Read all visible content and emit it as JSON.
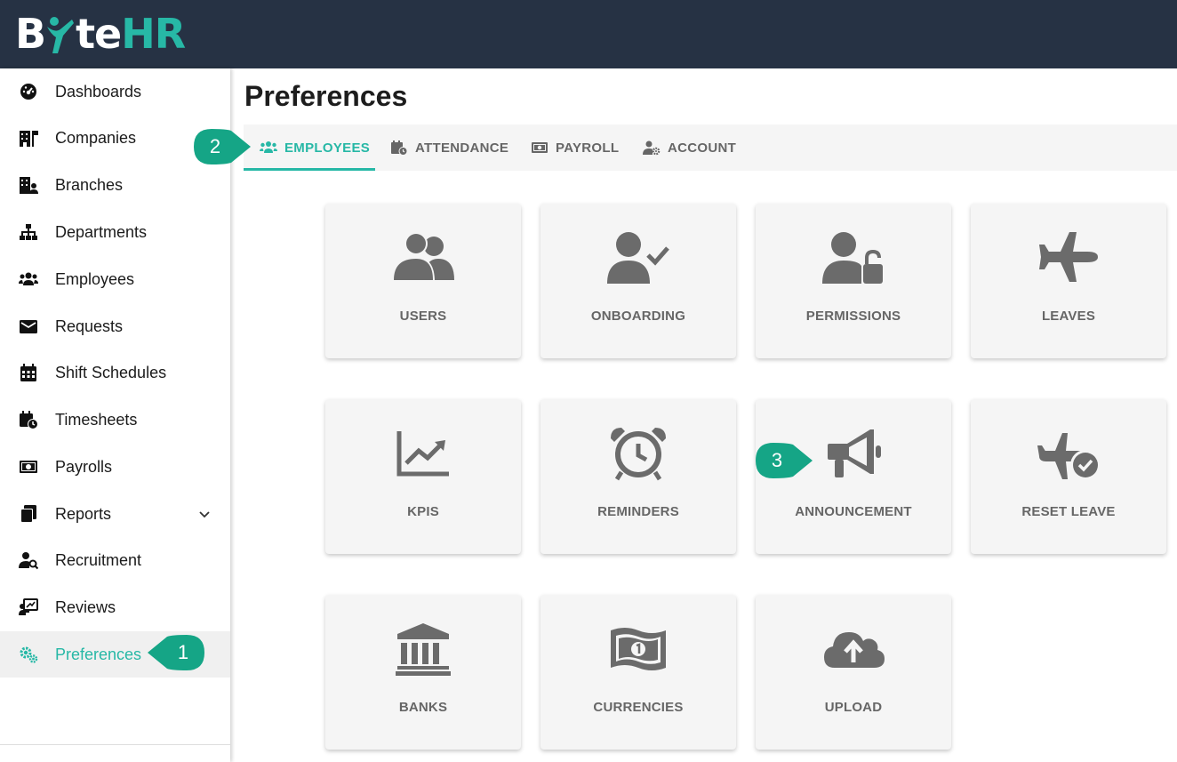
{
  "brand": {
    "logo_text": "ByteHR",
    "logo_part1": "B",
    "logo_part2": "te",
    "logo_part3": "HR",
    "accent": "#27b8a6",
    "header_bg": "#263244"
  },
  "sidebar": {
    "items": [
      {
        "label": "Dashboards",
        "icon": "dashboard-gauge-icon"
      },
      {
        "label": "Companies",
        "icon": "building-flag-icon"
      },
      {
        "label": "Branches",
        "icon": "building-user-icon"
      },
      {
        "label": "Departments",
        "icon": "org-chart-icon"
      },
      {
        "label": "Employees",
        "icon": "users-icon"
      },
      {
        "label": "Requests",
        "icon": "envelope-icon"
      },
      {
        "label": "Shift Schedules",
        "icon": "calendar-icon"
      },
      {
        "label": "Timesheets",
        "icon": "calendar-clock-icon"
      },
      {
        "label": "Payrolls",
        "icon": "money-bill-icon"
      },
      {
        "label": "Reports",
        "icon": "copy-document-icon",
        "expandable": true
      },
      {
        "label": "Recruitment",
        "icon": "user-search-icon"
      },
      {
        "label": "Reviews",
        "icon": "chalkboard-user-icon"
      },
      {
        "label": "Preferences",
        "icon": "gears-icon",
        "active": true
      }
    ]
  },
  "main": {
    "title": "Preferences",
    "tabs": [
      {
        "label": "EMPLOYEES",
        "icon": "users-icon",
        "active": true
      },
      {
        "label": "ATTENDANCE",
        "icon": "calendar-clock-icon"
      },
      {
        "label": "PAYROLL",
        "icon": "money-bill-icon"
      },
      {
        "label": "ACCOUNT",
        "icon": "user-gear-icon"
      }
    ],
    "cards": [
      {
        "label": "USERS",
        "icon": "users-icon"
      },
      {
        "label": "ONBOARDING",
        "icon": "user-check-icon"
      },
      {
        "label": "PERMISSIONS",
        "icon": "user-lock-icon"
      },
      {
        "label": "LEAVES",
        "icon": "plane-icon"
      },
      {
        "label": "KPIS",
        "icon": "chart-line-icon"
      },
      {
        "label": "REMINDERS",
        "icon": "alarm-clock-icon"
      },
      {
        "label": "ANNOUNCEMENT",
        "icon": "bullhorn-icon"
      },
      {
        "label": "RESET LEAVE",
        "icon": "plane-check-icon"
      },
      {
        "label": "BANKS",
        "icon": "bank-icon"
      },
      {
        "label": "CURRENCIES",
        "icon": "money-bill-wave-icon"
      },
      {
        "label": "UPLOAD",
        "icon": "cloud-upload-icon"
      }
    ]
  },
  "callouts": [
    {
      "number": "1"
    },
    {
      "number": "2"
    },
    {
      "number": "3"
    }
  ]
}
